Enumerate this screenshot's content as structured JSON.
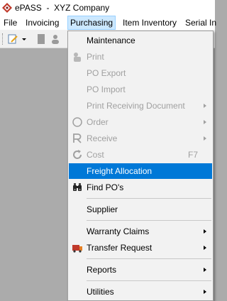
{
  "window": {
    "title": "ePASS  -  XYZ Company"
  },
  "menubar": {
    "items": [
      {
        "label": "File"
      },
      {
        "label": "Invoicing"
      },
      {
        "label": "Purchasing"
      },
      {
        "label": "Item Inventory"
      },
      {
        "label": "Serial In"
      }
    ]
  },
  "purchasing_menu": {
    "items": [
      {
        "label": "Maintenance",
        "enabled": true
      },
      {
        "label": "Print",
        "enabled": false
      },
      {
        "label": "PO Export",
        "enabled": false
      },
      {
        "label": "PO Import",
        "enabled": false
      },
      {
        "label": "Print Receiving Document",
        "enabled": false,
        "submenu": true
      },
      {
        "label": "Order",
        "enabled": false,
        "submenu": true
      },
      {
        "label": "Receive",
        "enabled": false,
        "submenu": true
      },
      {
        "label": "Cost",
        "enabled": false,
        "shortcut": "F7"
      },
      {
        "label": "Freight Allocation",
        "enabled": true,
        "highlighted": true
      },
      {
        "label": "Find PO's",
        "enabled": true
      },
      {
        "label": "Supplier",
        "enabled": true
      },
      {
        "label": "Warranty Claims",
        "enabled": true,
        "submenu": true
      },
      {
        "label": "Transfer Request",
        "enabled": true,
        "submenu": true
      },
      {
        "label": "Reports",
        "enabled": true,
        "submenu": true
      },
      {
        "label": "Utilities",
        "enabled": true,
        "submenu": true
      }
    ]
  },
  "icons": {
    "app": "diamond-logo-icon",
    "print": "print-icon",
    "order": "circle-icon",
    "receive": "r-letter-icon",
    "cost": "refresh-icon",
    "find": "binoculars-icon",
    "transfer": "transfer-truck-icon"
  },
  "colors": {
    "highlight": "#0078d7",
    "menu_bg": "#f2f2f2",
    "disabled_text": "#a0a0a0",
    "mdi_bg": "#ababab"
  }
}
